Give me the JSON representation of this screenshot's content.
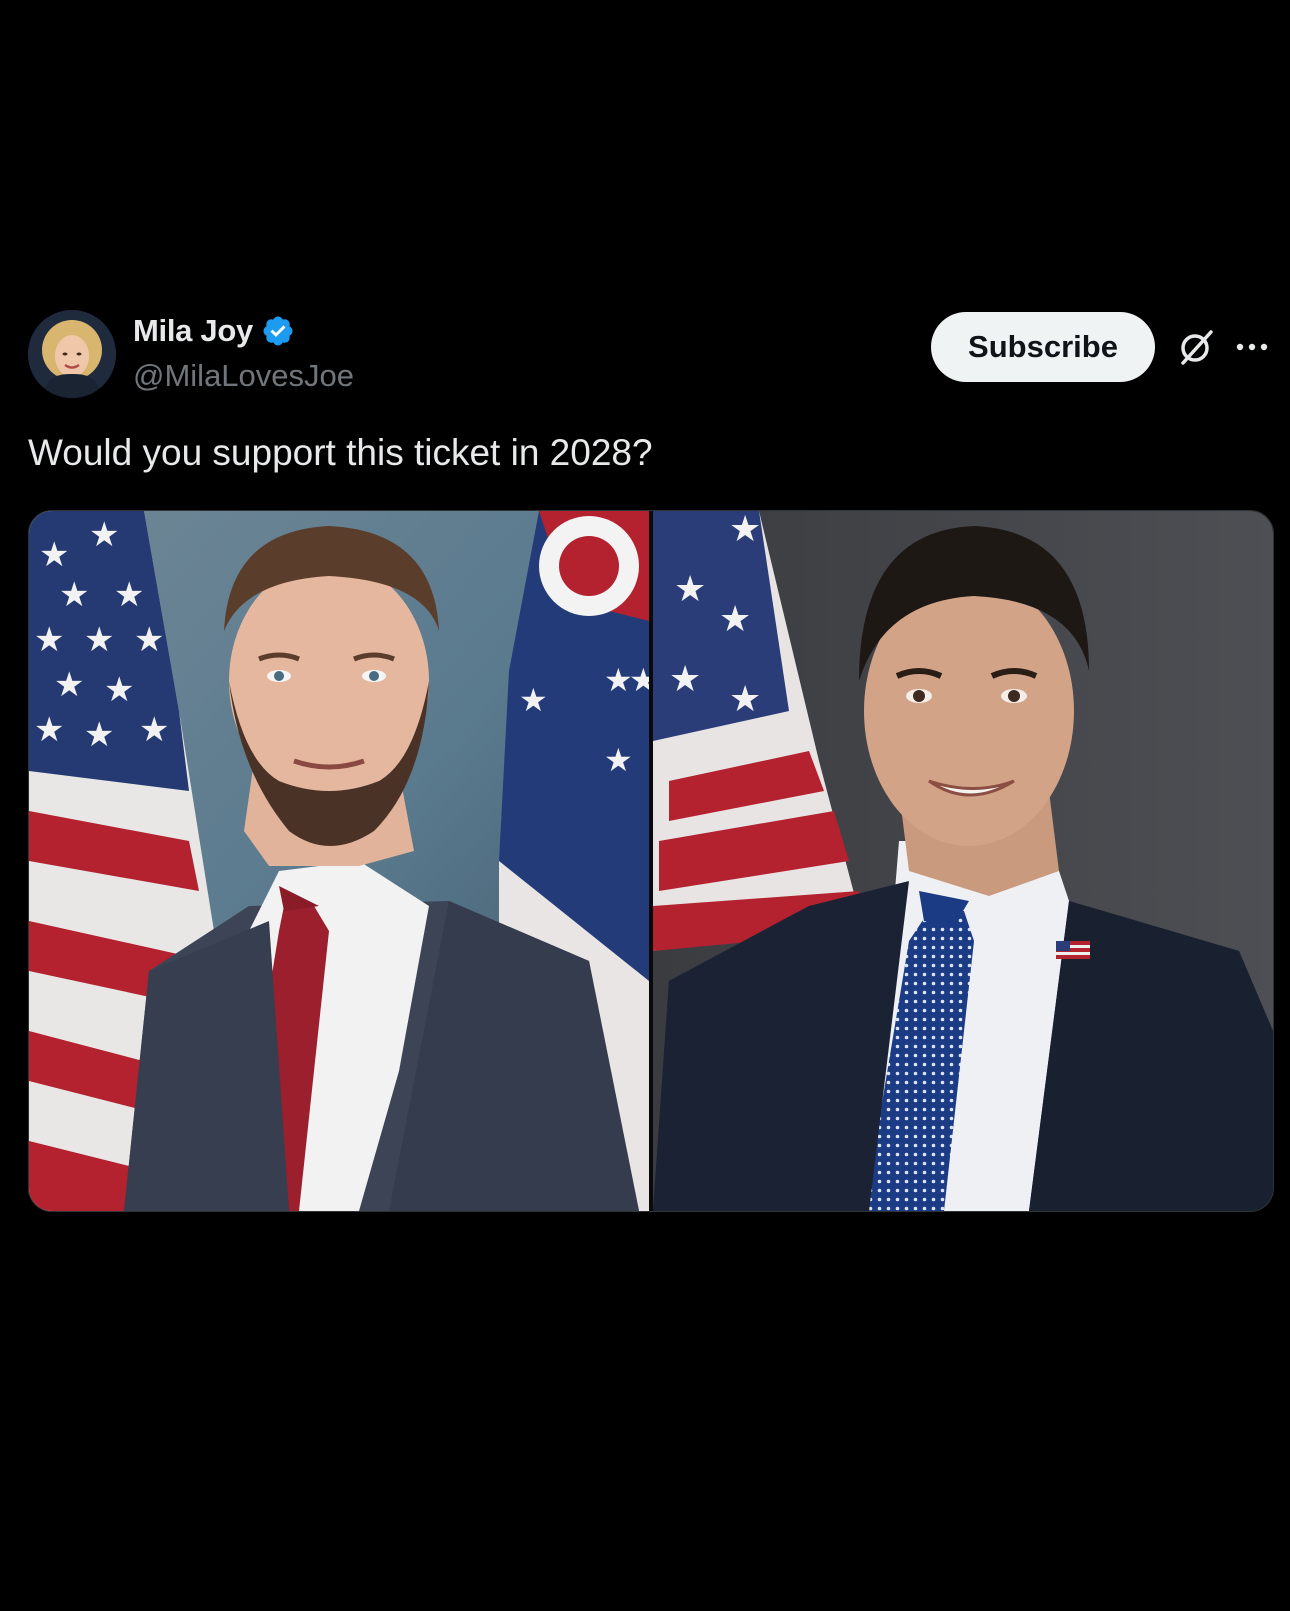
{
  "author": {
    "display_name": "Mila Joy",
    "handle": "@MilaLovesJoe",
    "verified": true,
    "avatar_icon": "profile-photo"
  },
  "actions": {
    "subscribe_label": "Subscribe",
    "grok_icon": "grok-icon",
    "more_icon": "more-dots-icon"
  },
  "post": {
    "text": "Would you support this ticket in 2028?",
    "media": {
      "layout": "side-by-side",
      "left_photo": "man in grey suit and red tie in front of American and Ohio flags",
      "right_photo": "man in navy suit and blue polka-dot tie in front of American flag"
    }
  },
  "colors": {
    "background": "#000000",
    "verified_blue": "#1d9bf0",
    "text_primary": "#e7e9ea",
    "text_secondary": "#71767b",
    "subscribe_bg": "#eff3f4"
  }
}
